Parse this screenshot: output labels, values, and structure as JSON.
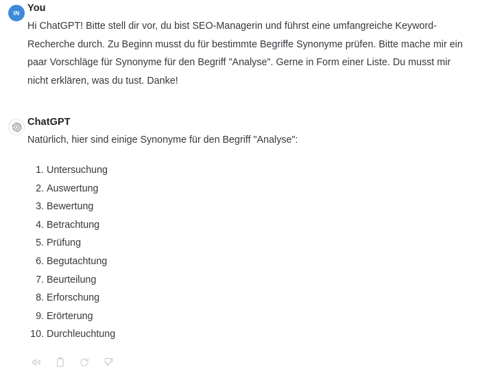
{
  "conversation": {
    "messages": [
      {
        "role": "user",
        "author": "You",
        "avatar_initials": "IN",
        "avatar_color": "#3d8ad9",
        "avatar_icon": "user-avatar",
        "text": "Hi ChatGPT! Bitte stell dir vor, du bist SEO-Managerin und führst eine umfangreiche Keyword-Recherche durch. Zu Beginn musst du für bestimmte Begriffe Synonyme prüfen. Bitte mache mir ein paar Vorschläge für Synonyme für den Begriff \"Analyse\". Gerne in Form einer Liste. Du musst mir nicht erklären, was du tust. Danke!"
      },
      {
        "role": "assistant",
        "author": "ChatGPT",
        "avatar_icon": "openai-logo-icon",
        "intro": "Natürlich, hier sind einige Synonyme für den Begriff \"Analyse\":",
        "list": [
          {
            "number": "1.",
            "label": "Untersuchung"
          },
          {
            "number": "2.",
            "label": "Auswertung"
          },
          {
            "number": "3.",
            "label": "Bewertung"
          },
          {
            "number": "4.",
            "label": "Betrachtung"
          },
          {
            "number": "5.",
            "label": "Prüfung"
          },
          {
            "number": "6.",
            "label": "Begutachtung"
          },
          {
            "number": "7.",
            "label": "Beurteilung"
          },
          {
            "number": "8.",
            "label": "Erforschung"
          },
          {
            "number": "9.",
            "label": "Erörterung"
          },
          {
            "number": "10.",
            "label": "Durchleuchtung"
          }
        ],
        "actions": [
          {
            "icon": "speaker-read-aloud-icon",
            "label": "Read aloud"
          },
          {
            "icon": "clipboard-copy-icon",
            "label": "Copy"
          },
          {
            "icon": "regenerate-icon",
            "label": "Regenerate"
          },
          {
            "icon": "thumbs-down-icon",
            "label": "Bad response"
          }
        ]
      }
    ]
  },
  "theme": {
    "background": "#ffffff",
    "text_color": "#34373c",
    "author_color": "#1f2023",
    "icon_color": "#c8cacd",
    "avatar_user_bg": "#3d8ad9"
  }
}
